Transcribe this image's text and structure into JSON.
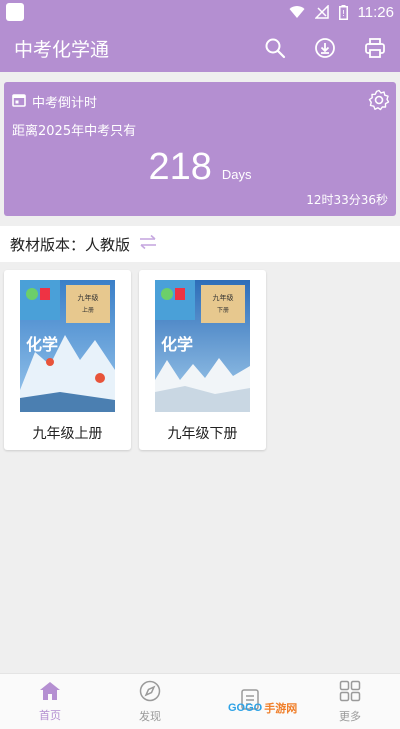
{
  "status_bar": {
    "time": "11:26"
  },
  "app_bar": {
    "title": "中考化学通"
  },
  "countdown": {
    "header": "中考倒计时",
    "subtitle": "距离2025年中考只有",
    "days": "218",
    "unit": "Days",
    "time_left": "12时33分36秒"
  },
  "version": {
    "label": "教材版本：人教版"
  },
  "books": [
    {
      "title": "九年级上册",
      "cover_text": "化学",
      "cover_grade": "九年级",
      "cover_volume": "上册"
    },
    {
      "title": "九年级下册",
      "cover_text": "化学",
      "cover_grade": "九年级",
      "cover_volume": "下册"
    }
  ],
  "nav": [
    {
      "label": "首页",
      "icon": "home-icon"
    },
    {
      "label": "发现",
      "icon": "compass-icon"
    },
    {
      "label": "",
      "icon": "document-icon"
    },
    {
      "label": "更多",
      "icon": "grid-icon"
    }
  ],
  "watermark": {
    "brand": "GOGO",
    "suffix": "手游网"
  },
  "colors": {
    "accent": "#b48fd1",
    "background": "#efefef"
  }
}
